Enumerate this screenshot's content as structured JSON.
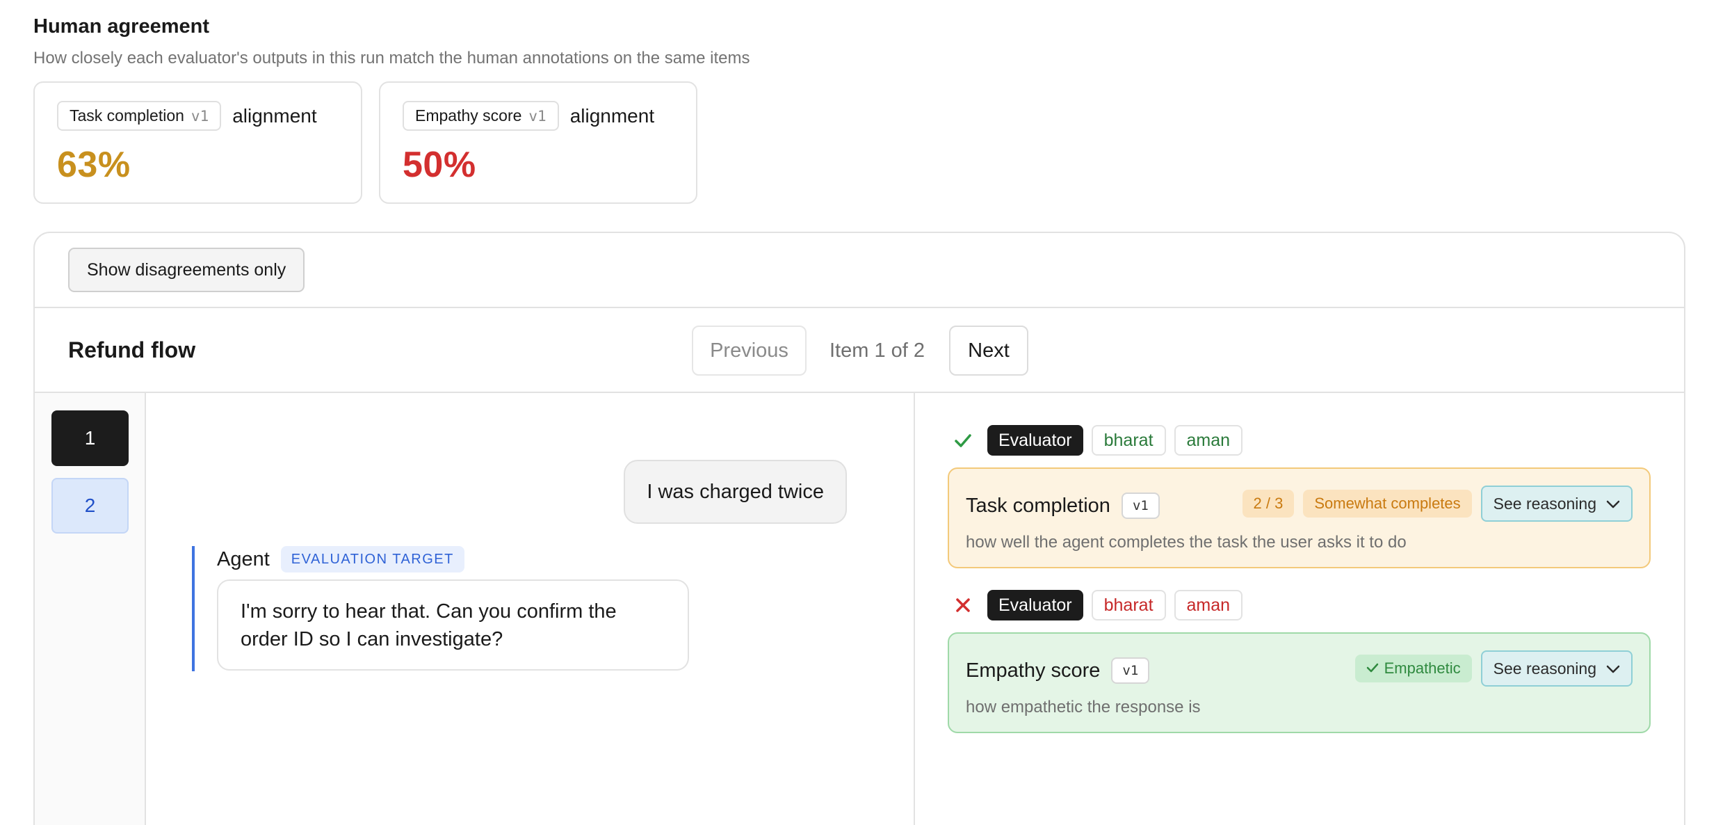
{
  "header": {
    "title": "Human agreement",
    "subtitle": "How closely each evaluator's outputs in this run match the human annotations on the same items"
  },
  "metrics": [
    {
      "evaluator": "Task completion",
      "version": "v1",
      "label": "alignment",
      "value": "63%",
      "color": "#c8901e"
    },
    {
      "evaluator": "Empathy score",
      "version": "v1",
      "label": "alignment",
      "value": "50%",
      "color": "#d32f2f"
    }
  ],
  "toolbar": {
    "disagreements_label": "Show disagreements only"
  },
  "item": {
    "title": "Refund flow",
    "previous_label": "Previous",
    "counter": "Item 1 of 2",
    "next_label": "Next"
  },
  "rail": {
    "items": [
      "1",
      "2"
    ]
  },
  "conversation": {
    "user_message": "I was charged twice",
    "agent_name": "Agent",
    "agent_badge": "EVALUATION TARGET",
    "agent_message": "I'm sorry to hear that. Can you confirm the order ID so I can investigate?"
  },
  "evaluations": [
    {
      "status": "agree",
      "tags": [
        "Evaluator",
        "bharat",
        "aman"
      ],
      "name": "Task completion",
      "version": "v1",
      "score": "2 / 3",
      "verdict": "Somewhat completes",
      "reasoning_label": "See reasoning",
      "description": "how well the agent completes the task the user asks it to do"
    },
    {
      "status": "disagree",
      "tags": [
        "Evaluator",
        "bharat",
        "aman"
      ],
      "name": "Empathy score",
      "version": "v1",
      "verdict": "Empathetic",
      "reasoning_label": "See reasoning",
      "description": "how empathetic the response is"
    }
  ]
}
